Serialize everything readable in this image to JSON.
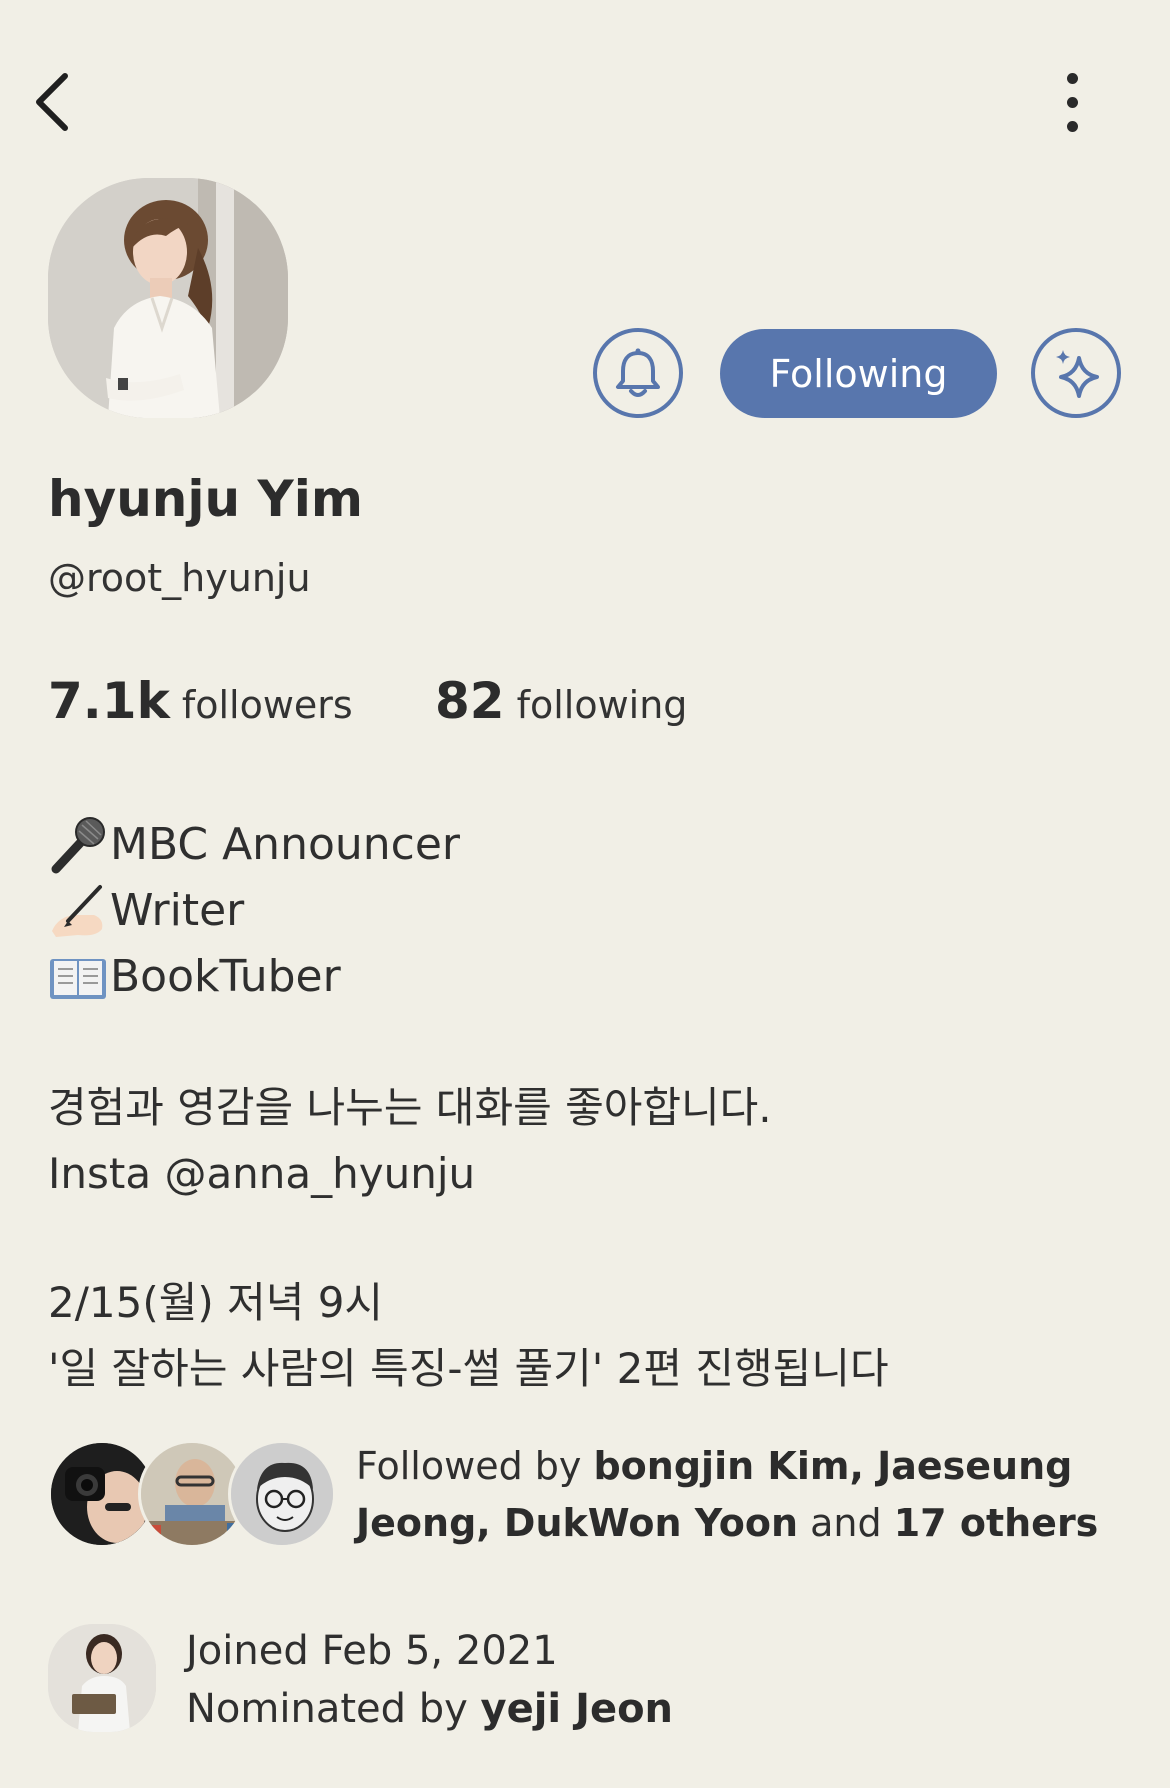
{
  "topbar": {
    "back_icon": "chevron-left-icon",
    "more_icon": "vertical-dots-icon"
  },
  "profile": {
    "name": "hyunju Yim",
    "handle": "@root_hyunju",
    "avatar": "profile-photo"
  },
  "actions": {
    "bell_icon": "bell-icon",
    "follow_label": "Following",
    "sparkle_icon": "sparkles-icon",
    "accent_color": "#5876ad"
  },
  "stats": {
    "followers_count": "7.1k",
    "followers_label": "followers",
    "following_count": "82",
    "following_label": "following"
  },
  "bio": {
    "lines": [
      {
        "emoji": "microphone-emoji",
        "text": "MBC Announcer"
      },
      {
        "emoji": "writing-hand-emoji",
        "text": "Writer"
      },
      {
        "emoji": "open-book-emoji",
        "text": "BookTuber"
      }
    ],
    "desc_line1": "경험과 영감을 나누는 대화를 좋아합니다.",
    "desc_line2": "Insta @anna_hyunju",
    "event_line1": "2/15(월) 저녁 9시",
    "event_line2": "'일 잘하는 사람의 특징-썰 풀기' 2편 진행됩니다"
  },
  "followed_by": {
    "prefix": "Followed by",
    "names": "bongjin Kim, Jaeseung Jeong, DukWon Yoon",
    "connector": "and",
    "others": "17 others"
  },
  "joined": {
    "joined_text": "Joined Feb 5, 2021",
    "nominated_prefix": "Nominated by",
    "nominated_name": "yeji Jeon"
  }
}
